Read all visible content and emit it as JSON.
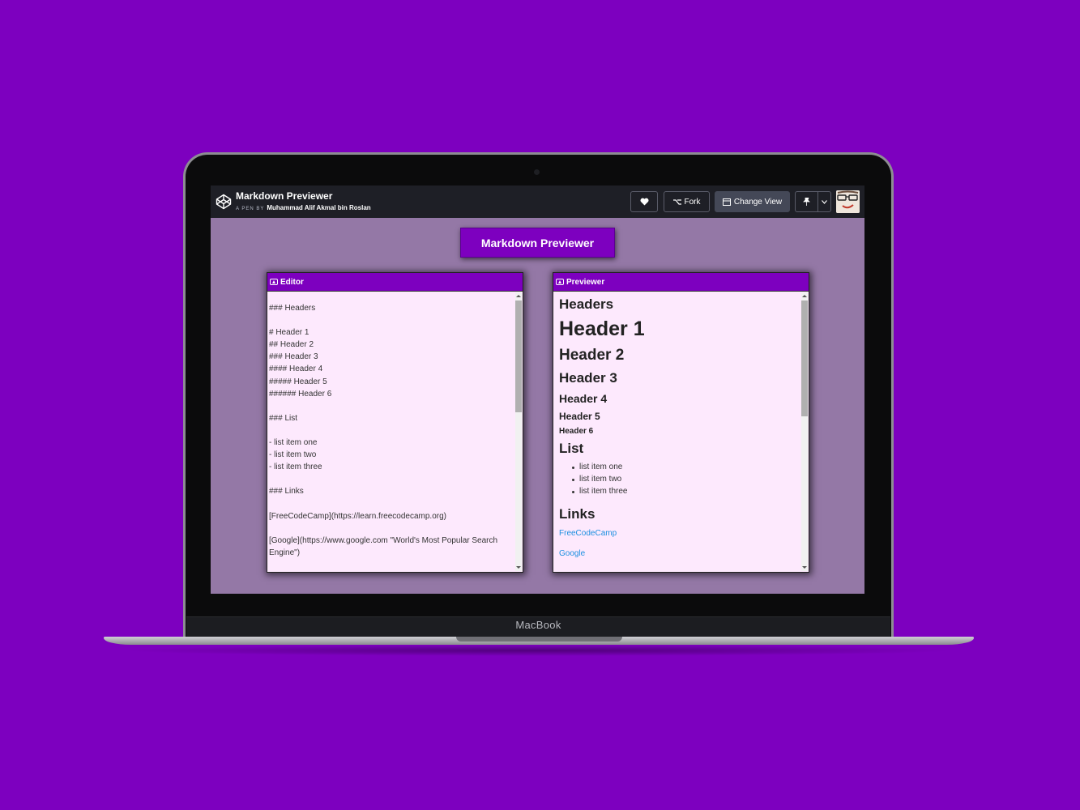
{
  "device": {
    "brand": "MacBook"
  },
  "codepen": {
    "pen_title": "Markdown Previewer",
    "by_prefix": "A PEN BY",
    "author": "Muhammad Alif Akmal bin Roslan",
    "fork_label": "Fork",
    "change_view_label": "Change View"
  },
  "app": {
    "title": "Markdown Previewer",
    "editor": {
      "header": "Editor",
      "content": "### Headers\n\n# Header 1\n## Header 2\n### Header 3\n#### Header 4\n##### Header 5\n###### Header 6\n\n### List\n\n- list item one\n- list item two\n- list item three\n\n### Links\n\n[FreeCodeCamp](https://learn.freecodecamp.org)\n\n[Google](https://www.google.com \"World's Most Popular Search Engine\")"
    },
    "previewer": {
      "header": "Previewer",
      "headers_title": "Headers",
      "h1": "Header 1",
      "h2": "Header 2",
      "h3": "Header 3",
      "h4": "Header 4",
      "h5": "Header 5",
      "h6": "Header 6",
      "list_title": "List",
      "list_items": [
        "list item one",
        "list item two",
        "list item three"
      ],
      "links_title": "Links",
      "links": [
        "FreeCodeCamp",
        "Google"
      ]
    }
  },
  "colors": {
    "accent": "#7d00bf",
    "page_bg": "#9478a6",
    "panel_bg": "#fde9fd",
    "link": "#1a8fe0"
  }
}
